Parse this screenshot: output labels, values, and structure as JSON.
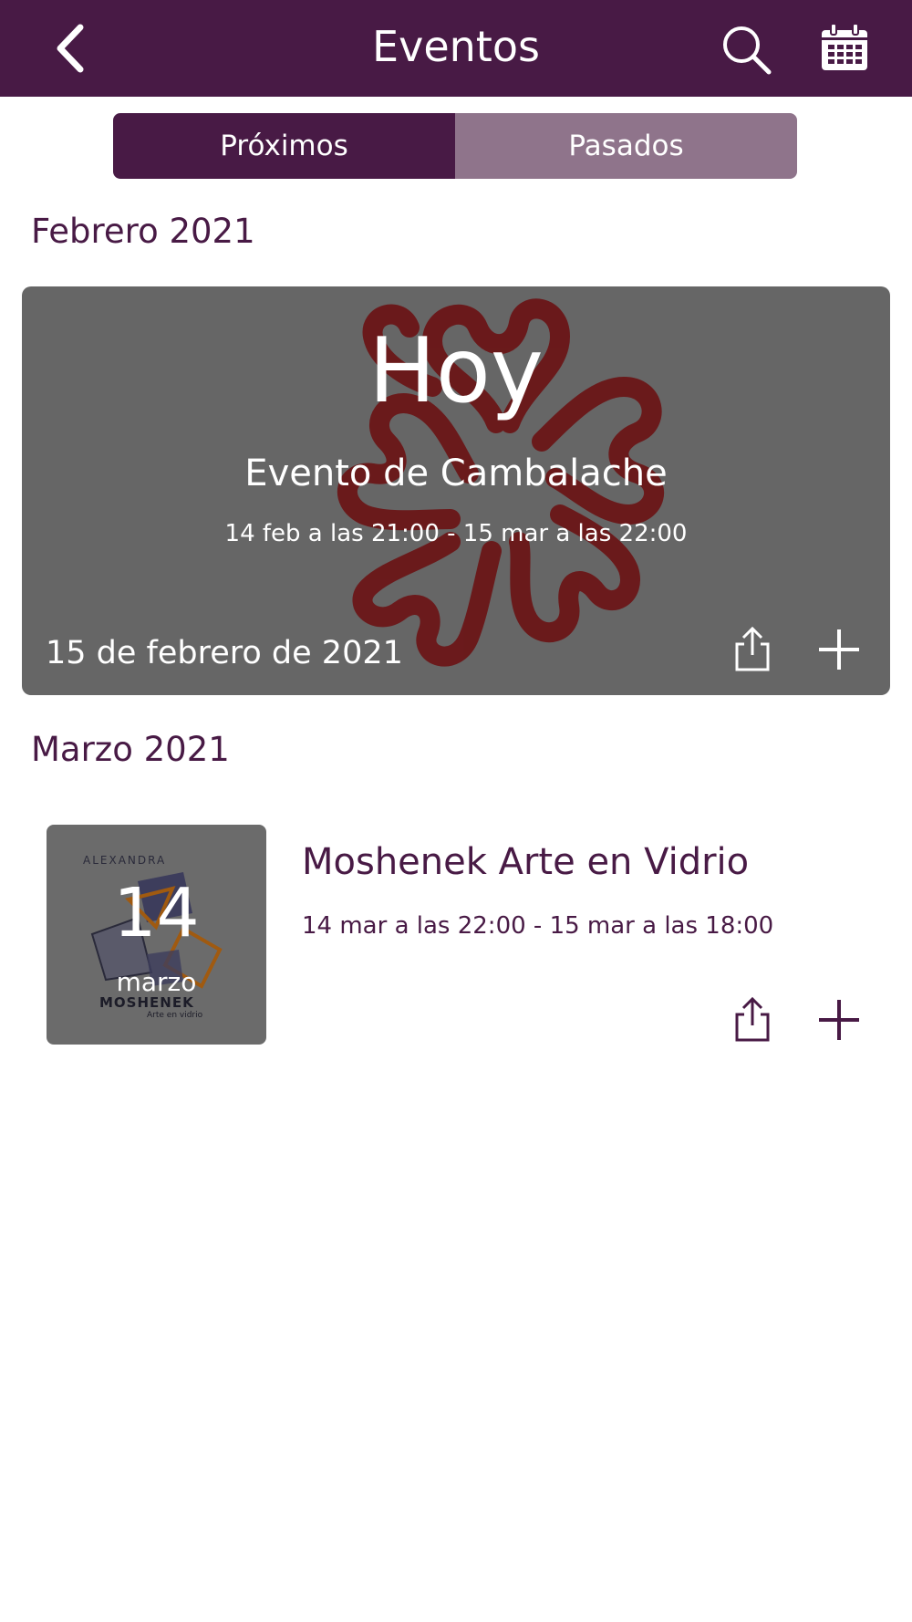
{
  "header": {
    "title": "Eventos",
    "back_icon": "chevron-left-icon",
    "search_icon": "search-icon",
    "calendar_icon": "calendar-icon"
  },
  "tabs": [
    {
      "label": "Próximos",
      "active": true
    },
    {
      "label": "Pasados",
      "active": false
    }
  ],
  "sections": [
    {
      "month": "Febrero 2021",
      "featured": {
        "badge": "Hoy",
        "title": "Evento de Cambalache",
        "time": "14 feb a las 21:00 - 15 mar a las 22:00",
        "date": "15 de febrero de 2021"
      }
    },
    {
      "month": "Marzo 2021",
      "events": [
        {
          "day": "14",
          "month_short": "marzo",
          "logo_name": "ALEXANDRA",
          "logo_brand": "MOSHENEK",
          "logo_sub": "Arte en vidrio",
          "title": "Moshenek Arte en Vidrio",
          "time": "14 mar a las 22:00 - 15 mar a las 18:00"
        }
      ]
    }
  ],
  "colors": {
    "brand": "#481a45",
    "tab_inactive": "#8f748b",
    "card_bg": "#666666",
    "emblem": "#6b1618"
  }
}
